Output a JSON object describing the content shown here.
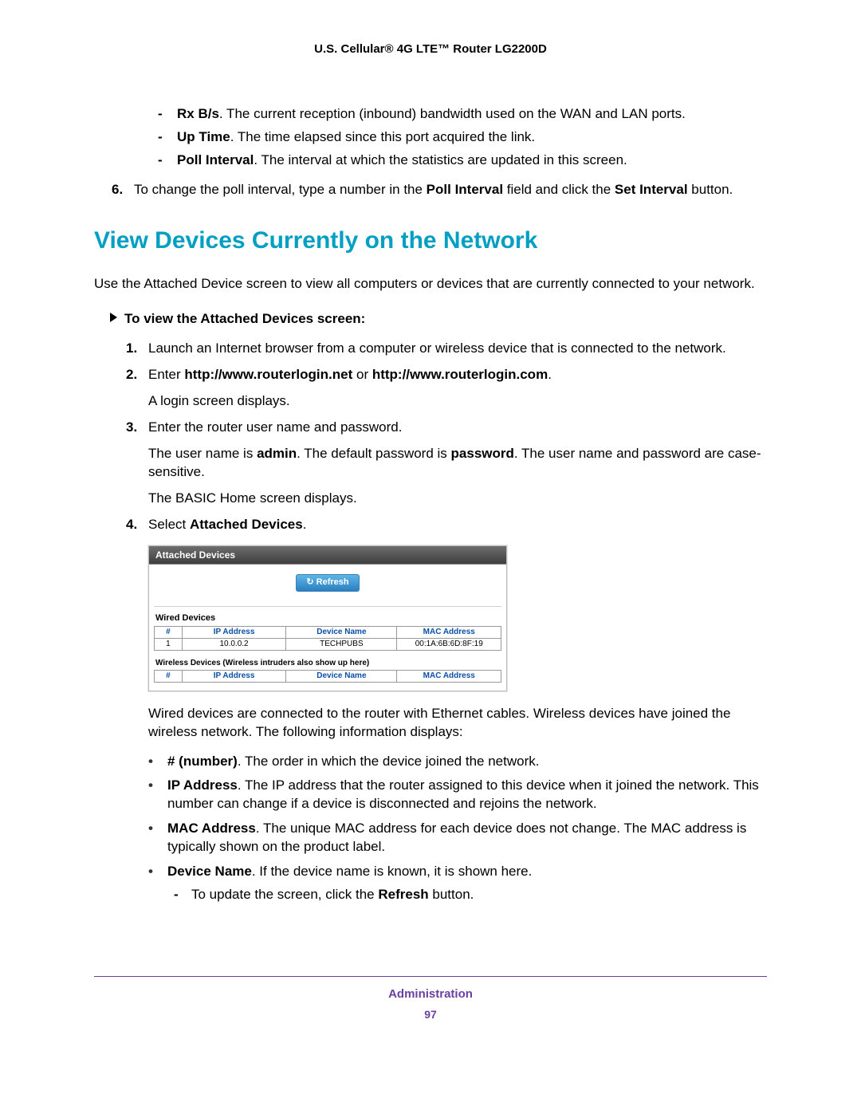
{
  "header": {
    "title": "U.S. Cellular® 4G LTE™ Router LG2200D"
  },
  "continued": {
    "rx_bs_label": "Rx B/s",
    "rx_bs_text": ". The current reception (inbound) bandwidth used on the WAN and LAN ports.",
    "uptime_label": "Up Time",
    "uptime_text": ". The time elapsed since this port acquired the link.",
    "pollint_label": "Poll Interval",
    "pollint_text": ". The interval at which the statistics are updated in this screen.",
    "step6_num": "6.",
    "step6_a": "To change the poll interval, type a number in the ",
    "step6_b": "Poll Interval",
    "step6_c": " field and click the ",
    "step6_d": "Set Interval",
    "step6_e": " button."
  },
  "section": {
    "heading": "View Devices Currently on the Network",
    "intro": "Use the Attached Device screen to view all computers or devices that are currently connected to your network.",
    "task": "To view the Attached Devices screen:"
  },
  "steps": {
    "s1_n": "1.",
    "s1": "Launch an Internet browser from a computer or wireless device that is connected to the network.",
    "s2_n": "2.",
    "s2_a": "Enter ",
    "s2_b": "http://www.routerlogin.net",
    "s2_c": " or ",
    "s2_d": "http://www.routerlogin.com",
    "s2_e": ".",
    "s2_f": "A login screen displays.",
    "s3_n": "3.",
    "s3_a": "Enter the router user name and password.",
    "s3_b1": "The user name is ",
    "s3_b2": "admin",
    "s3_b3": ". The default password is ",
    "s3_b4": "password",
    "s3_b5": ". The user name and password are case-sensitive.",
    "s3_c": "The BASIC Home screen displays.",
    "s4_n": "4.",
    "s4_a": "Select ",
    "s4_b": "Attached Devices",
    "s4_c": "."
  },
  "panel": {
    "title": "Attached Devices",
    "refresh": "Refresh",
    "wired_label": "Wired Devices",
    "wireless_label": "Wireless Devices (Wireless intruders also show up here)",
    "cols": {
      "num": "#",
      "ip": "IP Address",
      "name": "Device Name",
      "mac": "MAC Address"
    },
    "wired_rows": [
      {
        "num": "1",
        "ip": "10.0.0.2",
        "name": "TECHPUBS",
        "mac": "00:1A:6B:6D:8F:19"
      }
    ]
  },
  "after_panel": "Wired devices are connected to the router with Ethernet cables. Wireless devices have joined the wireless network. The following information displays:",
  "fields": {
    "num_label": "# (number)",
    "num_text": ". The order in which the device joined the network.",
    "ip_label": "IP Address",
    "ip_text": ". The IP address that the router assigned to this device when it joined the network. This number can change if a device is disconnected and rejoins the network.",
    "mac_label": "MAC Address",
    "mac_text": ". The unique MAC address for each device does not change. The MAC address is typically shown on the product label.",
    "dn_label": "Device Name",
    "dn_text": ". If the device name is known, it is shown here.",
    "refresh_a": "To update the screen, click the ",
    "refresh_b": "Refresh",
    "refresh_c": " button."
  },
  "footer": {
    "section": "Administration",
    "page": "97"
  }
}
